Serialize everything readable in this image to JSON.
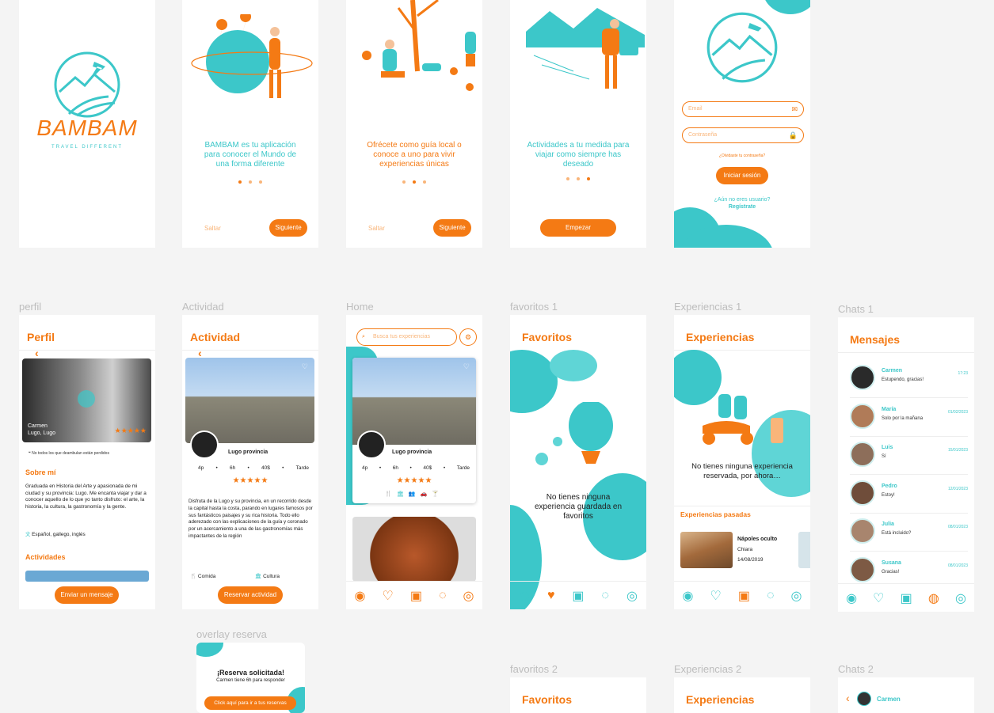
{
  "labels": {
    "perfil": "perfil",
    "actividad": "Actividad",
    "home": "Home",
    "favoritos1": "favoritos 1",
    "experiencias1": "Experiencias 1",
    "chats1": "Chats 1",
    "overlay": "overlay reserva",
    "favoritos2": "favoritos 2",
    "experiencias2": "Experiencias 2",
    "chats2": "Chats 2"
  },
  "splash": {
    "brand": "BAMBAM",
    "tagline": "TRAVEL DIFFERENT"
  },
  "intro1": {
    "text": "BAMBAM es tu aplicación para conocer el Mundo de una forma diferente",
    "skip": "Saltar",
    "next": "Siguiente"
  },
  "intro2": {
    "text": "Ofrécete como guía local o conoce a uno para vivir experiencias únicas",
    "skip": "Saltar",
    "next": "Siguiente"
  },
  "intro3": {
    "text": "Actividades a tu medida para viajar como siempre has deseado",
    "start": "Empezar"
  },
  "login": {
    "email": "Email",
    "password": "Contraseña",
    "forgot": "¿Olvidaste tu contraseña?",
    "submit": "Iniciar sesión",
    "no_user": "¿Aún no eres usuario?",
    "register": "Regístrate"
  },
  "perfil": {
    "title": "Perfil",
    "name": "Carmen",
    "place": "Lugo, Lugo",
    "stars": "★★★★★",
    "quote": "No todos los que deambulan están perdidos",
    "about_title": "Sobre mí",
    "about": "Graduada en Historia del Arte y apasionada de mi ciudad y su provincia: Lugo. Me encanta viajar y dar a conocer aquello de lo que yo tanto disfruto: el arte, la historia, la cultura, la gastronomía y la gente.",
    "languages": "Español, gallego, inglés",
    "activities_title": "Actividades",
    "cta": "Enviar un mensaje"
  },
  "actividad": {
    "title": "Actividad",
    "place": "Lugo provincia",
    "meta": [
      "4p",
      "6h",
      "40$",
      "Tarde"
    ],
    "stars": "★★★★★",
    "desc": "Disfruta de la Lugo y su provincia, en un recorrido desde la capital hasta la costa, parando en lugares famosos por sus fantásticos paisajes y su rica historia. Todo ello aderezado con las explicaciones de la guía y coronado por un acercamiento a una de las gastronomías más impactantes de la región",
    "tag1": "Comida",
    "tag2": "Cultura",
    "cta": "Reservar actividad"
  },
  "home": {
    "search": "Busca tus experiencias",
    "place": "Lugo provincia",
    "meta": [
      "4p",
      "6h",
      "40$",
      "Tarde"
    ],
    "stars": "★★★★★"
  },
  "favoritos": {
    "title": "Favoritos",
    "empty": "No tienes ninguna experiencia guardada en favoritos"
  },
  "experiencias": {
    "title": "Experiencias",
    "empty": "No tienes ninguna experiencia reservada, por ahora…",
    "past_title": "Experiencias pasadas",
    "past_place": "Nápoles oculto",
    "past_guide": "Chiara",
    "past_date": "14/08/2019"
  },
  "mensajes": {
    "title": "Mensajes",
    "chats": [
      {
        "name": "Carmen",
        "msg": "Estupendo, gracias!",
        "time": "17:23"
      },
      {
        "name": "María",
        "msg": "Solo por la mañana",
        "time": "01/02/2023"
      },
      {
        "name": "Luis",
        "msg": "Sí",
        "time": "15/01/2023"
      },
      {
        "name": "Pedro",
        "msg": "Estoy!",
        "time": "12/01/2023"
      },
      {
        "name": "Julia",
        "msg": "Está incluido?",
        "time": "08/01/2023"
      },
      {
        "name": "Susana",
        "msg": "Gracias!",
        "time": "08/01/2023"
      }
    ]
  },
  "overlay": {
    "title": "¡Reserva solicitada!",
    "sub": "Carmen tiene 6h para responder",
    "cta": "Click aquí para ir a tus reservas"
  },
  "chats2": {
    "name": "Carmen"
  },
  "colors": {
    "orange": "#f47a14",
    "teal": "#3cc7c9"
  }
}
